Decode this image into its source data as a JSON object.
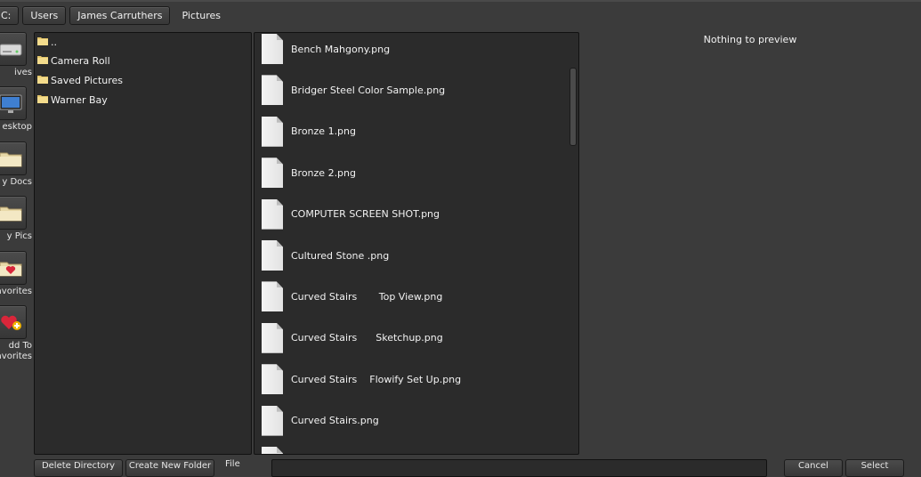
{
  "breadcrumb": [
    {
      "label": "C:",
      "active": false
    },
    {
      "label": "Users",
      "active": false
    },
    {
      "label": "James Carruthers",
      "active": false
    },
    {
      "label": "Pictures",
      "active": true
    }
  ],
  "places": [
    {
      "label": "ives",
      "icon": "drive-icon"
    },
    {
      "label": "esktop",
      "icon": "monitor-icon"
    },
    {
      "label": "y Docs",
      "icon": "folder-icon"
    },
    {
      "label": "y Pics",
      "icon": "folder-icon"
    },
    {
      "label": "avorites",
      "icon": "heart-folder-icon"
    },
    {
      "label": "dd To\navorites",
      "icon": "add-favorite-icon"
    }
  ],
  "directories": [
    {
      "label": ".."
    },
    {
      "label": "Camera Roll"
    },
    {
      "label": "Saved Pictures"
    },
    {
      "label": "Warner Bay"
    }
  ],
  "files": [
    {
      "name": "Bench Mahgony.png"
    },
    {
      "name": "Bridger Steel Color Sample.png"
    },
    {
      "name": "Bronze 1.png"
    },
    {
      "name": "Bronze 2.png"
    },
    {
      "name": "COMPUTER SCREEN SHOT.png"
    },
    {
      "name": "Cultured Stone .png"
    },
    {
      "name": "Curved Stairs       Top View.png"
    },
    {
      "name": "Curved Stairs      Sketchup.png"
    },
    {
      "name": "Curved Stairs    Flowify Set Up.png"
    },
    {
      "name": "Curved Stairs.png"
    },
    {
      "name": ""
    }
  ],
  "preview": {
    "empty_text": "Nothing to preview"
  },
  "bottom": {
    "delete_button": "Delete Directory",
    "new_folder_button": "Create New Folder",
    "filename_label": "File",
    "filename_value": "",
    "cancel_button": "Cancel",
    "ok_button": "Select"
  },
  "colors": {
    "background": "#3b3b3b",
    "pane": "#2b2b2b",
    "text": "#f2f2f2"
  }
}
